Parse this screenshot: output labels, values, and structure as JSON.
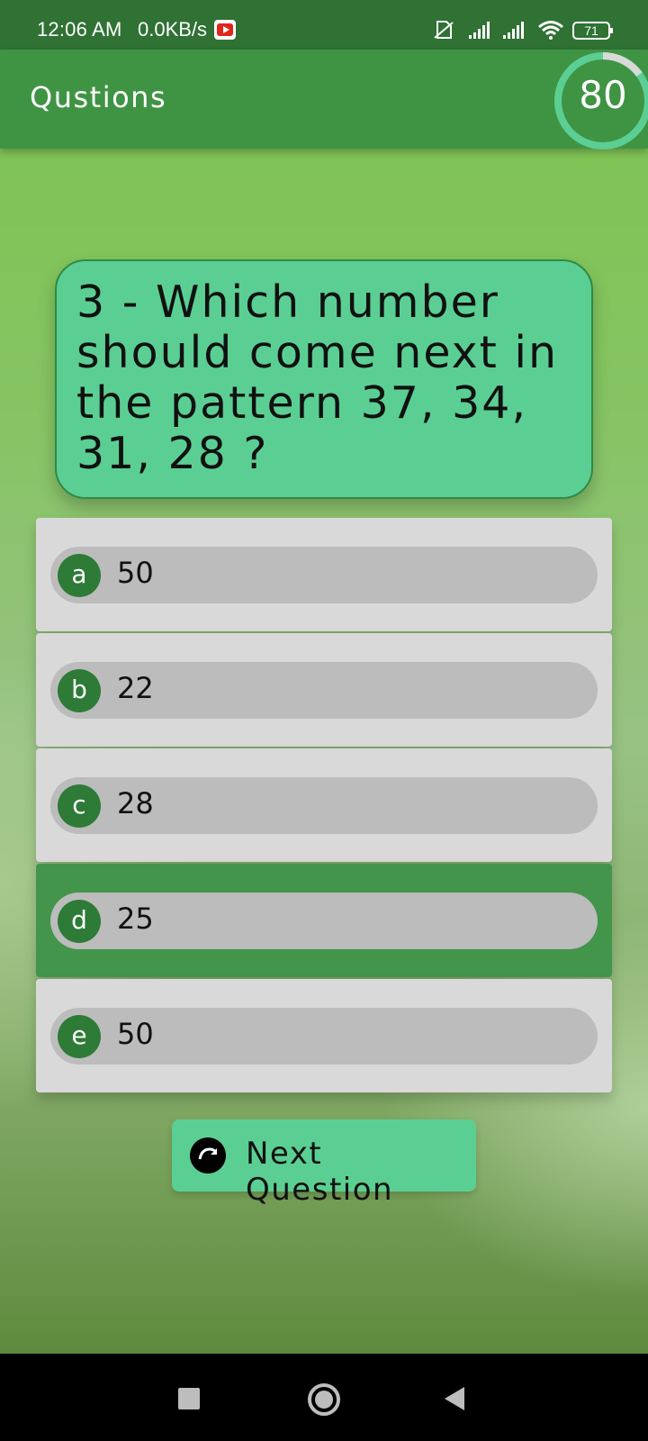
{
  "status_bar": {
    "time": "12:06 AM",
    "network_speed": "0.0KB/s",
    "notification_icon": "youtube-icon",
    "battery_level": "71"
  },
  "app_bar": {
    "title": "Qustions",
    "score": "80",
    "timer_progress": 0.15
  },
  "question": {
    "text": "3 - Which number should come next in the pattern 37, 34, 31, 28 ?"
  },
  "options": [
    {
      "letter": "a",
      "value": "50",
      "selected": false
    },
    {
      "letter": "b",
      "value": "22",
      "selected": false
    },
    {
      "letter": "c",
      "value": "28",
      "selected": false
    },
    {
      "letter": "d",
      "value": "25",
      "selected": true
    },
    {
      "letter": "e",
      "value": "50",
      "selected": false
    }
  ],
  "next_button": {
    "label": "Next Question",
    "icon": "redo-arrow-icon"
  },
  "colors": {
    "app_bar": "#3f9444",
    "status_bar": "#2f7234",
    "card": "#5bcf93",
    "selected_option": "#43954b",
    "letter_badge": "#2e7a37"
  },
  "nav_bar": {
    "icons": [
      "recent-apps-icon",
      "home-icon",
      "back-icon"
    ]
  }
}
